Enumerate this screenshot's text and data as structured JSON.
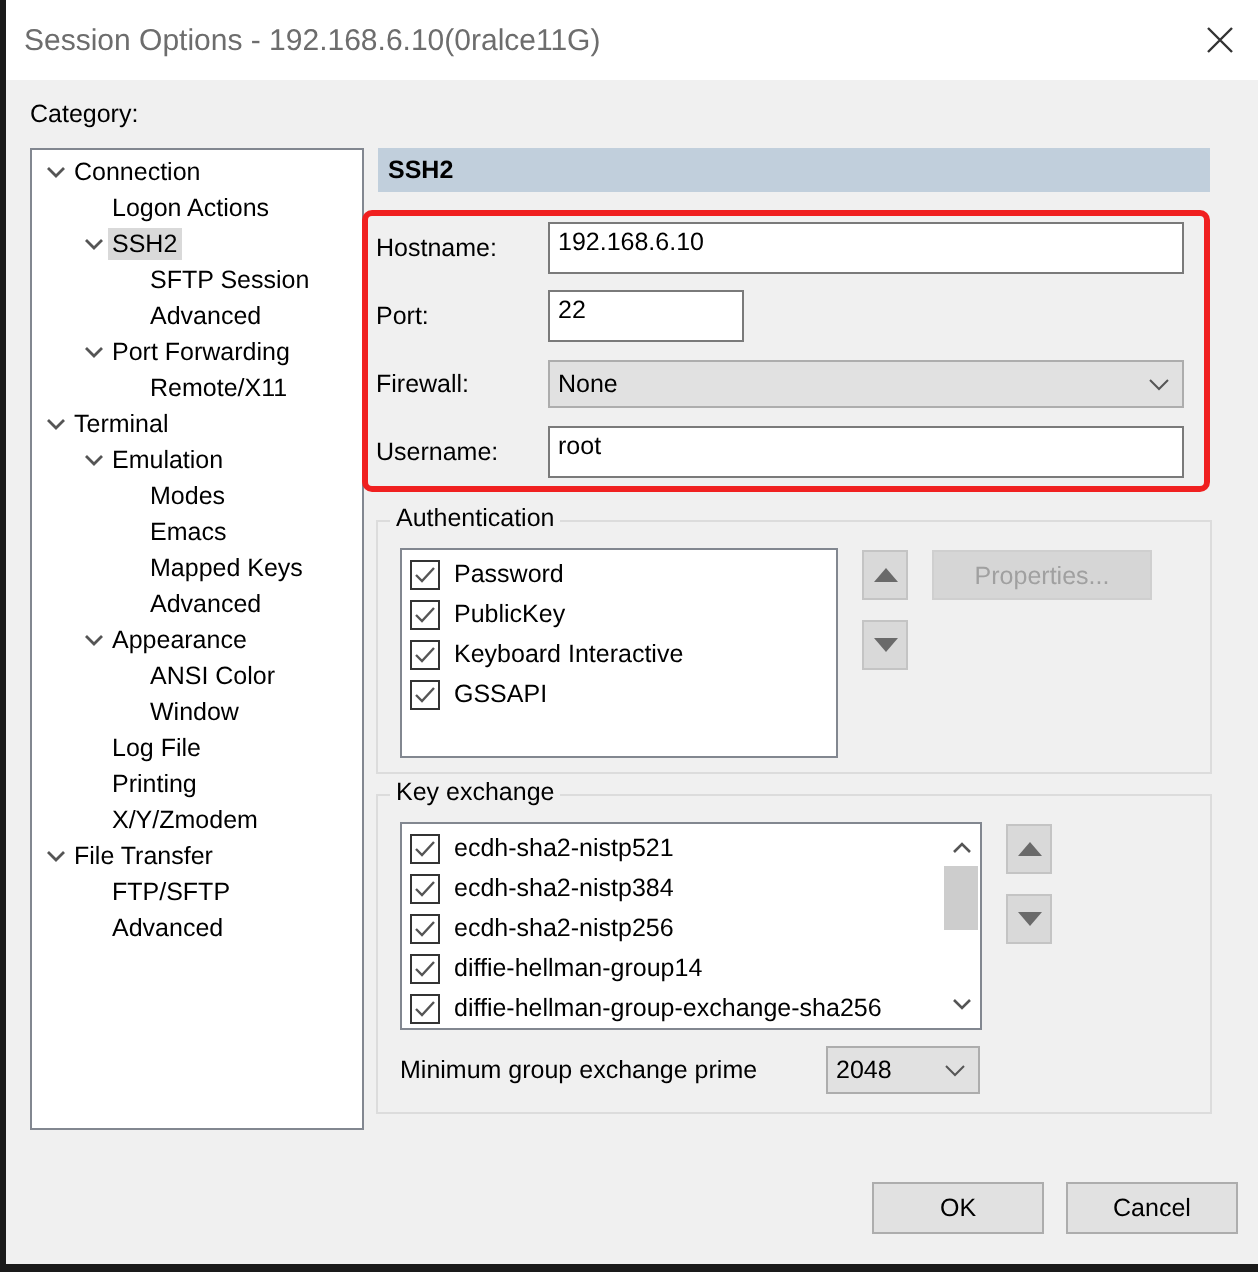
{
  "window": {
    "title": "Session Options - 192.168.6.10(0ralce11G)"
  },
  "category": {
    "label": "Category:",
    "tree": [
      {
        "label": "Connection",
        "expanded": true,
        "selected": false,
        "children": [
          {
            "label": "Logon Actions",
            "selected": false
          },
          {
            "label": "SSH2",
            "expanded": true,
            "selected": true,
            "children": [
              {
                "label": "SFTP Session",
                "selected": false
              },
              {
                "label": "Advanced",
                "selected": false
              }
            ]
          },
          {
            "label": "Port Forwarding",
            "expanded": true,
            "selected": false,
            "children": [
              {
                "label": "Remote/X11",
                "selected": false
              }
            ]
          }
        ]
      },
      {
        "label": "Terminal",
        "expanded": true,
        "selected": false,
        "children": [
          {
            "label": "Emulation",
            "expanded": true,
            "selected": false,
            "children": [
              {
                "label": "Modes",
                "selected": false
              },
              {
                "label": "Emacs",
                "selected": false
              },
              {
                "label": "Mapped Keys",
                "selected": false
              },
              {
                "label": "Advanced",
                "selected": false
              }
            ]
          },
          {
            "label": "Appearance",
            "expanded": true,
            "selected": false,
            "children": [
              {
                "label": "ANSI Color",
                "selected": false
              },
              {
                "label": "Window",
                "selected": false
              }
            ]
          },
          {
            "label": "Log File",
            "selected": false
          },
          {
            "label": "Printing",
            "selected": false
          },
          {
            "label": "X/Y/Zmodem",
            "selected": false
          }
        ]
      },
      {
        "label": "File Transfer",
        "expanded": true,
        "selected": false,
        "children": [
          {
            "label": "FTP/SFTP",
            "selected": false
          },
          {
            "label": "Advanced",
            "selected": false
          }
        ]
      }
    ]
  },
  "panel": {
    "title": "SSH2",
    "fields": [
      {
        "kind": "text",
        "label": "Hostname:",
        "value": "192.168.6.10"
      },
      {
        "kind": "short",
        "label": "Port:",
        "value": "22"
      },
      {
        "kind": "select",
        "label": "Firewall:",
        "value": "None"
      },
      {
        "kind": "text",
        "label": "Username:",
        "value": "root"
      }
    ],
    "authentication": {
      "title": "Authentication",
      "items": [
        {
          "label": "Password",
          "checked": true
        },
        {
          "label": "PublicKey",
          "checked": true
        },
        {
          "label": "Keyboard Interactive",
          "checked": true
        },
        {
          "label": "GSSAPI",
          "checked": true
        }
      ],
      "properties_button": "Properties..."
    },
    "key_exchange": {
      "title": "Key exchange",
      "items": [
        {
          "label": "ecdh-sha2-nistp521",
          "checked": true
        },
        {
          "label": "ecdh-sha2-nistp384",
          "checked": true
        },
        {
          "label": "ecdh-sha2-nistp256",
          "checked": true
        },
        {
          "label": "diffie-hellman-group14",
          "checked": true
        },
        {
          "label": "diffie-hellman-group-exchange-sha256",
          "checked": true
        }
      ],
      "min_prime_label": "Minimum group exchange prime",
      "min_prime_value": "2048"
    }
  },
  "buttons": [
    "OK",
    "Cancel"
  ]
}
